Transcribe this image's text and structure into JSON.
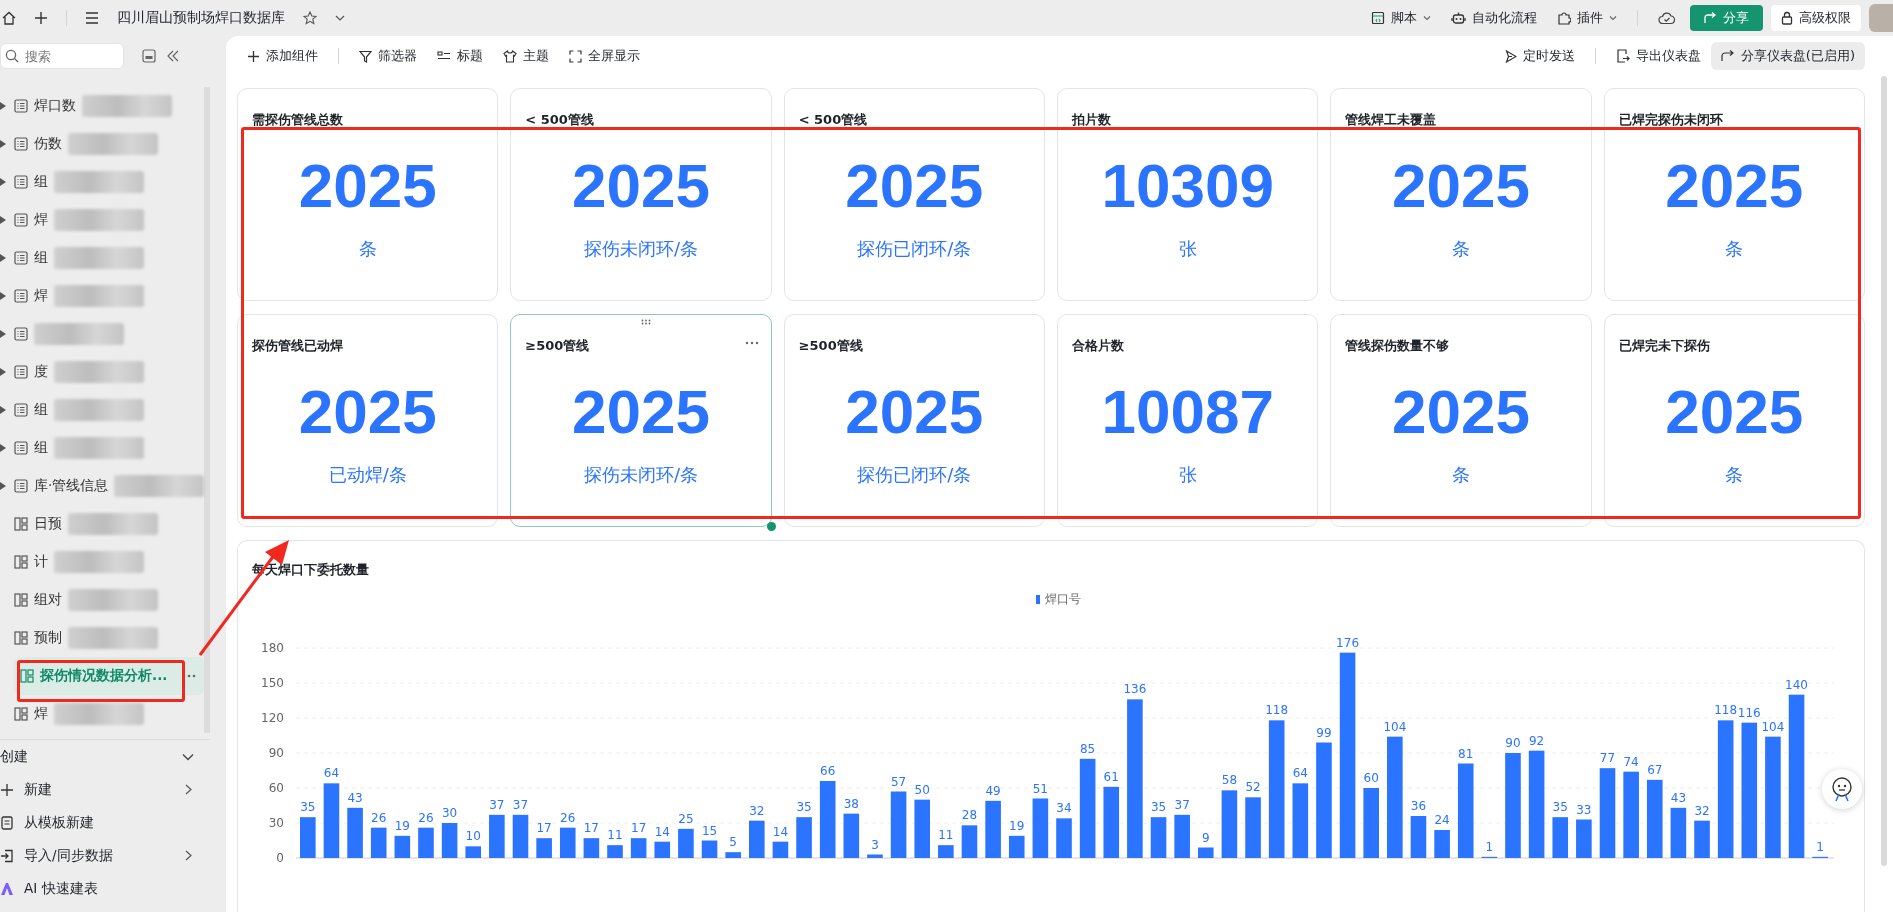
{
  "app_bar": {
    "title": "四川眉山预制场焊口数据库",
    "right_items": [
      {
        "label": "脚本",
        "kind": "dropdown"
      },
      {
        "label": "自动化流程",
        "kind": "plain"
      },
      {
        "label": "插件",
        "kind": "dropdown"
      }
    ],
    "share_button": "分享",
    "permission_button": "高级权限"
  },
  "sidebar": {
    "search": {
      "placeholder": "搜索"
    },
    "items": [
      {
        "label": "焊口数",
        "kind": "table",
        "expandable": true,
        "blurred": true,
        "selected": false
      },
      {
        "label": "伤数",
        "kind": "table",
        "expandable": true,
        "blurred": true,
        "selected": false
      },
      {
        "label": "组",
        "kind": "table",
        "expandable": true,
        "blurred": true,
        "selected": false
      },
      {
        "label": "焊",
        "kind": "table",
        "expandable": true,
        "blurred": true,
        "selected": false
      },
      {
        "label": "组",
        "kind": "table",
        "expandable": true,
        "blurred": true,
        "selected": false
      },
      {
        "label": "焊",
        "kind": "table",
        "expandable": true,
        "blurred": true,
        "selected": false
      },
      {
        "kind": "table",
        "expandable": true,
        "blurred": true,
        "selected": false
      },
      {
        "label": "度",
        "kind": "table",
        "expandable": true,
        "blurred": true,
        "selected": false
      },
      {
        "label": "组",
        "kind": "table",
        "expandable": true,
        "blurred": true,
        "selected": false
      },
      {
        "label": "组",
        "kind": "table",
        "expandable": true,
        "blurred": true,
        "selected": false
      },
      {
        "label": "库·管线信息",
        "kind": "table",
        "expandable": true,
        "blurred": true,
        "selected": false
      },
      {
        "label": "日预",
        "kind": "dashboard",
        "expandable": false,
        "blurred": true,
        "selected": false
      },
      {
        "label": "计",
        "kind": "dashboard",
        "expandable": false,
        "blurred": true,
        "selected": false
      },
      {
        "label": "组对",
        "kind": "dashboard",
        "expandable": false,
        "blurred": true,
        "selected": false
      },
      {
        "label": "预制",
        "kind": "dashboard",
        "expandable": false,
        "blurred": true,
        "selected": false
      },
      {
        "label": "探伤情况数据分析...",
        "kind": "dashboard",
        "expandable": false,
        "blurred": false,
        "selected": true
      },
      {
        "label": "焊",
        "kind": "dashboard",
        "expandable": false,
        "blurred": true,
        "selected": false
      }
    ],
    "create_section": {
      "title": "创建",
      "expanded": true,
      "items": [
        {
          "label": "新建",
          "kind": "new",
          "has_submenu": true
        },
        {
          "label": "从模板新建",
          "kind": "template",
          "has_submenu": false
        },
        {
          "label": "导入/同步数据",
          "kind": "import",
          "has_submenu": true
        },
        {
          "label": "AI 快速建表",
          "kind": "ai",
          "has_submenu": false
        }
      ]
    }
  },
  "toolbar": {
    "left": [
      "添加组件",
      "筛选器",
      "标题",
      "主题",
      "全屏显示"
    ],
    "right": [
      {
        "label": "定时发送",
        "kind": "plain"
      },
      {
        "label": "导出仪表盘",
        "kind": "plain"
      },
      {
        "label": "分享仪表盘(已启用)",
        "kind": "filled"
      }
    ]
  },
  "cards": [
    {
      "title": "需探伤管线总数",
      "value": "2025",
      "unit": "条",
      "selected": false
    },
    {
      "title": "< 500管线",
      "value": "2025",
      "unit": "探伤未闭环/条",
      "selected": false
    },
    {
      "title": "< 500管线",
      "value": "2025",
      "unit": "探伤已闭环/条",
      "selected": false
    },
    {
      "title": "拍片数",
      "value": "10309",
      "unit": "张",
      "selected": false
    },
    {
      "title": "管线焊工未覆盖",
      "value": "2025",
      "unit": "条",
      "selected": false
    },
    {
      "title": "已焊完探伤未闭环",
      "value": "2025",
      "unit": "条",
      "selected": false
    },
    {
      "title": "探伤管线已动焊",
      "value": "2025",
      "unit": "已动焊/条",
      "selected": false
    },
    {
      "title": "≥500管线",
      "value": "2025",
      "unit": "探伤未闭环/条",
      "selected": true
    },
    {
      "title": "≥500管线",
      "value": "2025",
      "unit": "探伤已闭环/条",
      "selected": false
    },
    {
      "title": "合格片数",
      "value": "10087",
      "unit": "张",
      "selected": false
    },
    {
      "title": "管线探伤数量不够",
      "value": "2025",
      "unit": "条",
      "selected": false
    },
    {
      "title": "已焊完未下探伤",
      "value": "2025",
      "unit": "条",
      "selected": false
    }
  ],
  "chart_panel": {
    "title": "每天焊口下委托数量",
    "chart_data": {
      "type": "bar",
      "ylim": [
        0,
        180
      ],
      "yticks": [
        0,
        30,
        60,
        90,
        120,
        150,
        180
      ],
      "grid": true,
      "data_labels": true,
      "series": [
        {
          "name": "焊口号",
          "color": "#2b74ff",
          "values": [
            35,
            64,
            43,
            26,
            19,
            26,
            30,
            10,
            37,
            37,
            17,
            26,
            17,
            11,
            17,
            14,
            25,
            15,
            5,
            32,
            14,
            35,
            66,
            38,
            3,
            57,
            50,
            11,
            28,
            49,
            19,
            51,
            34,
            85,
            61,
            136,
            35,
            37,
            9,
            58,
            52,
            118,
            64,
            99,
            176,
            60,
            104,
            36,
            24,
            81,
            1,
            90,
            92,
            35,
            33,
            77,
            74,
            67,
            43,
            32,
            118,
            116,
            104,
            140,
            1
          ]
        }
      ]
    }
  }
}
